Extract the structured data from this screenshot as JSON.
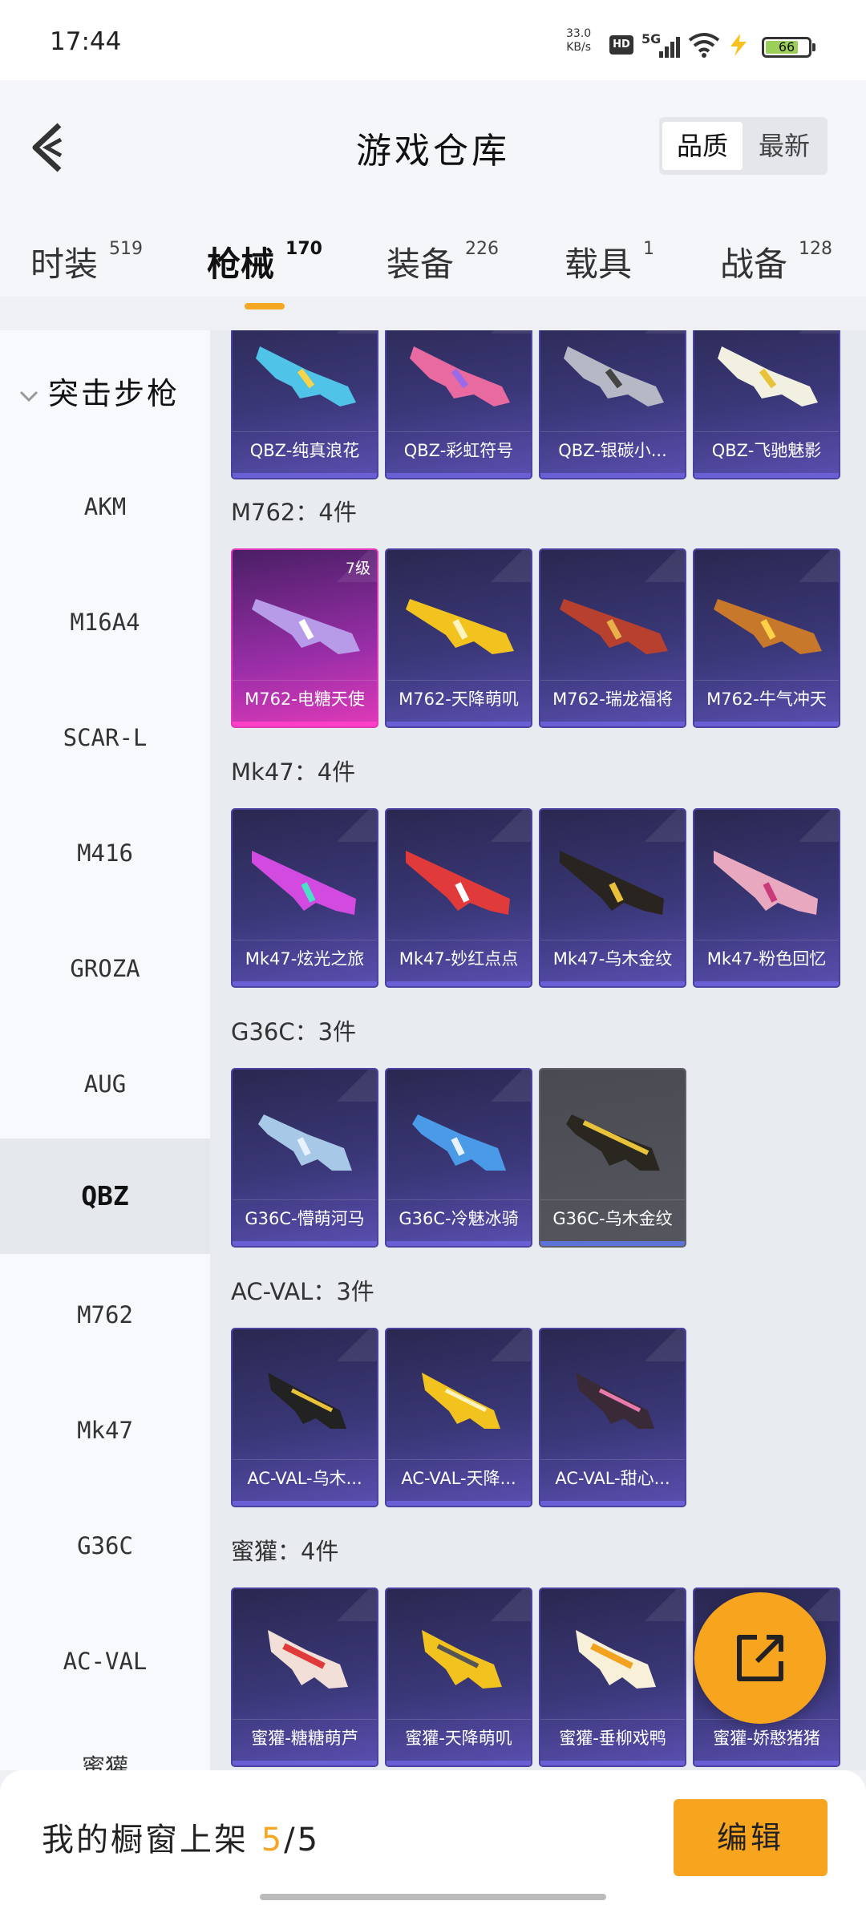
{
  "status": {
    "time": "17:44",
    "netspeed_value": "33.0",
    "netspeed_unit": "KB/s",
    "hd": "HD",
    "network": "5G",
    "battery": "66"
  },
  "header": {
    "title": "游戏仓库",
    "sort_quality": "品质",
    "sort_latest": "最新"
  },
  "tabs": [
    {
      "label": "时装",
      "count": "519"
    },
    {
      "label": "枪械",
      "count": "170"
    },
    {
      "label": "装备",
      "count": "226"
    },
    {
      "label": "载具",
      "count": "1"
    },
    {
      "label": "战备",
      "count": "128"
    }
  ],
  "active_tab": "枪械",
  "sidebar": {
    "category": "突击步枪",
    "items": [
      "AKM",
      "M16A4",
      "SCAR-L",
      "M416",
      "GROZA",
      "AUG",
      "QBZ",
      "M762",
      "Mk47",
      "G36C",
      "AC-VAL",
      "蜜獾"
    ],
    "active": "QBZ"
  },
  "groups": [
    {
      "title": "",
      "items": [
        "QBZ-纯真浪花",
        "QBZ-彩虹符号",
        "QBZ-银碳小...",
        "QBZ-飞驰魅影"
      ]
    },
    {
      "title": "M762：4件",
      "items": [
        "M762-电糖天使",
        "M762-天降萌叽",
        "M762-瑞龙福将",
        "M762-牛气冲天"
      ],
      "badge": "7级"
    },
    {
      "title": "Mk47：4件",
      "items": [
        "Mk47-炫光之旅",
        "Mk47-妙红点点",
        "Mk47-乌木金纹",
        "Mk47-粉色回忆"
      ]
    },
    {
      "title": "G36C：3件",
      "items": [
        "G36C-懵萌河马",
        "G36C-冷魅冰骑",
        "G36C-乌木金纹"
      ]
    },
    {
      "title": "AC-VAL：3件",
      "items": [
        "AC-VAL-乌木...",
        "AC-VAL-天降...",
        "AC-VAL-甜心..."
      ]
    },
    {
      "title": "蜜獾：4件",
      "items": [
        "蜜獾-糖糖萌芦",
        "蜜獾-天降萌叽",
        "蜜獾-垂柳戏鸭",
        "蜜獾-娇憨猪猪"
      ]
    }
  ],
  "bottom": {
    "shelf_label": "我的橱窗上架",
    "shelf_current": "5",
    "shelf_total": "/5",
    "edit": "编辑"
  },
  "colors": {
    "accent": "#f7a41f",
    "card_bg": "#3a3778",
    "card_rare": "#e03ab8"
  },
  "icons": [
    "back-chevron-icon",
    "share-external-icon",
    "chevron-down-icon",
    "wifi-icon",
    "battery-icon"
  ]
}
